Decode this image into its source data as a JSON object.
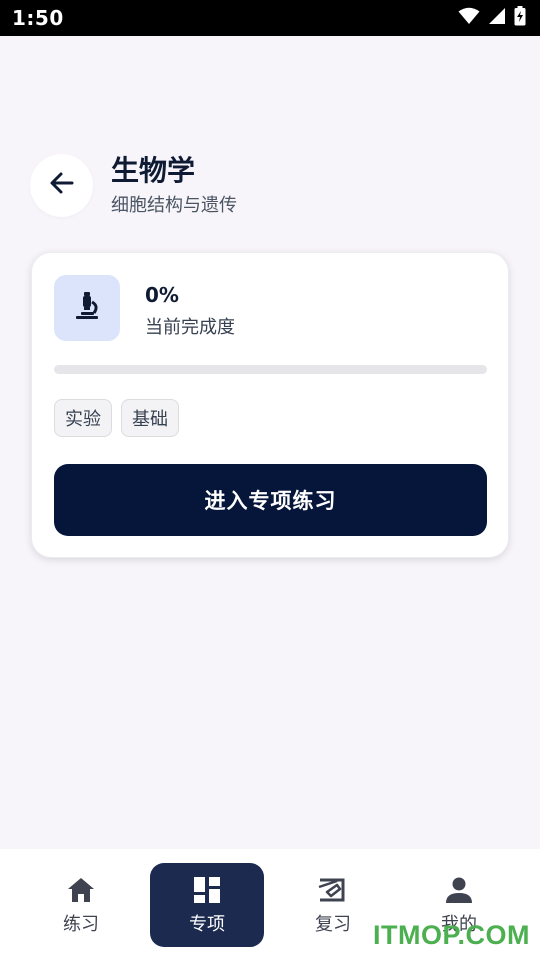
{
  "status_bar": {
    "time": "1:50",
    "icons": [
      "wifi-icon",
      "signal-icon",
      "battery-charging-icon"
    ]
  },
  "header": {
    "back_icon": "arrow-left-icon",
    "title": "生物学",
    "subtitle": "细胞结构与遗传"
  },
  "card": {
    "icon": "microscope-icon",
    "icon_bg": "#dbe4fb",
    "progress_value": "0%",
    "progress_fraction": 0,
    "progress_label": "当前完成度",
    "tags": [
      "实验",
      "基础"
    ],
    "enter_button": "进入专项练习"
  },
  "bottom_nav": {
    "items": [
      {
        "label": "练习",
        "icon": "home-icon",
        "active": false
      },
      {
        "label": "专项",
        "icon": "dashboard-icon",
        "active": true
      },
      {
        "label": "复习",
        "icon": "review-icon",
        "active": false
      },
      {
        "label": "我的",
        "icon": "person-icon",
        "active": false
      }
    ]
  },
  "watermark": "ITMOP.COM",
  "colors": {
    "primary": "#06163a",
    "nav_active": "#1b2a4e",
    "background": "#f7f5fa",
    "watermark": "#4caf50"
  }
}
